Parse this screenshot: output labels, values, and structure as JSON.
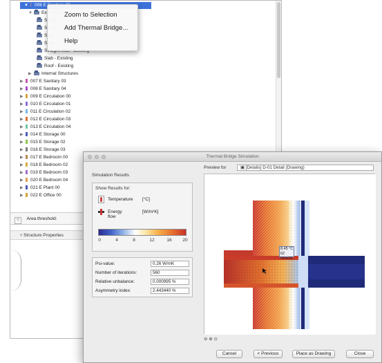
{
  "navigator": {
    "rows": [
      {
        "label": "006 E Sanitary 02",
        "indent": 20,
        "kind": "zone",
        "color": "#6a7ac0",
        "toggle": "▼",
        "selected": true
      },
      {
        "label": "External",
        "indent": 26,
        "kind": "folder",
        "toggle": "▼"
      },
      {
        "label": "Struct",
        "indent": 38,
        "kind": "building"
      },
      {
        "label": "Struct",
        "indent": 38,
        "kind": "building"
      },
      {
        "label": "Slab",
        "indent": 38,
        "kind": "building"
      },
      {
        "label": "Slab",
        "indent": 38,
        "kind": "building"
      },
      {
        "label": "Straight Wall - Existing",
        "indent": 38,
        "kind": "building"
      },
      {
        "label": "Slab - Existing",
        "indent": 38,
        "kind": "building"
      },
      {
        "label": "Roof - Existing",
        "indent": 38,
        "kind": "building"
      },
      {
        "label": "Internal Structures",
        "indent": 26,
        "kind": "folder",
        "toggle": "▶"
      },
      {
        "label": "007 E Sanitary 03",
        "indent": 14,
        "kind": "zone",
        "color": "#c35aa8",
        "toggle": "▶"
      },
      {
        "label": "008 E Sanitary 04",
        "indent": 14,
        "kind": "zone",
        "color": "#a84fc2",
        "toggle": "▶"
      },
      {
        "label": "009 E Circulation 00",
        "indent": 14,
        "kind": "zone",
        "color": "#d8a43c",
        "toggle": "▶"
      },
      {
        "label": "010 E Circulation 01",
        "indent": 14,
        "kind": "zone",
        "color": "#8d6ad1",
        "toggle": "▶"
      },
      {
        "label": "011 E Circulation 02",
        "indent": 14,
        "kind": "zone",
        "color": "#7ab6e8",
        "toggle": "▶"
      },
      {
        "label": "012 E Circulation 03",
        "indent": 14,
        "kind": "zone",
        "color": "#d9742e",
        "toggle": "▶"
      },
      {
        "label": "013 E Circulation 04",
        "indent": 14,
        "kind": "zone",
        "color": "#6cc6a5",
        "toggle": "▶"
      },
      {
        "label": "014 E Storage 00",
        "indent": 14,
        "kind": "zone",
        "color": "#4a5cb8",
        "toggle": "▶"
      },
      {
        "label": "015 E Storage 02",
        "indent": 14,
        "kind": "zone",
        "color": "#8ec74e",
        "toggle": "▶"
      },
      {
        "label": "016 E Storage 03",
        "indent": 14,
        "kind": "zone",
        "color": "#7a7a7a",
        "toggle": "▶"
      },
      {
        "label": "017 E Bedroom 00",
        "indent": 14,
        "kind": "zone",
        "color": "#b98b55",
        "toggle": "▶"
      },
      {
        "label": "018 E Bedroom 02",
        "indent": 14,
        "kind": "zone",
        "color": "#d6ad3e",
        "toggle": "▶"
      },
      {
        "label": "019 E Bedroom 03",
        "indent": 14,
        "kind": "zone",
        "color": "#a26cc9",
        "toggle": "▶"
      },
      {
        "label": "020 E Bedroom 04",
        "indent": 14,
        "kind": "zone",
        "color": "#d8a050",
        "toggle": "▶"
      },
      {
        "label": "021 E Plant 00",
        "indent": 14,
        "kind": "zone",
        "color": "#4b54b3",
        "toggle": "▶"
      },
      {
        "label": "022 E Office 00",
        "indent": 14,
        "kind": "zone",
        "color": "#d9a23a",
        "toggle": "▶"
      }
    ],
    "area_threshold_label": "Area threshold:",
    "structure_properties_label": "Structure Properties"
  },
  "context_menu": {
    "items": [
      "Zoom to Selection",
      "Add Thermal Bridge...",
      "Help"
    ]
  },
  "dialog": {
    "title": "Thermal Bridge Simulation",
    "simulation_results_label": "Simulation Results",
    "show_results_for_label": "Show Results for:",
    "temperature_label": "Temperature",
    "temperature_unit": "[°C]",
    "energy_flow_label": "Energy flow",
    "energy_flow_unit": "[W/m²K]",
    "scale_ticks": [
      "0",
      "4",
      "8",
      "12",
      "16",
      "20"
    ],
    "stats": [
      {
        "label": "Psi-value:",
        "value": "0.26 W/mK"
      },
      {
        "label": "Number of iterations:",
        "value": "560"
      },
      {
        "label": "Relative unbalance:",
        "value": "0.000995 %"
      },
      {
        "label": "Asymmetry index:",
        "value": "2.443440 %"
      }
    ],
    "preview_for_label": "Preview for",
    "preview_value": "[Details] D-01 Detail (Drawing)",
    "tooltip_lines": [
      "8.45 °C",
      "62 W/m2K"
    ],
    "zoom_tools": "⊖ ⊕ ⊙",
    "buttons": {
      "cancel": "Cancel",
      "previous": "< Previous",
      "place_as_drawing": "Place as Drawing",
      "close": "Close"
    }
  },
  "colors": {
    "selection": "#3d73d9",
    "window_bg": "#ececec",
    "cold_blue": "#1f2a78",
    "warm_orange": "#e6742a"
  }
}
